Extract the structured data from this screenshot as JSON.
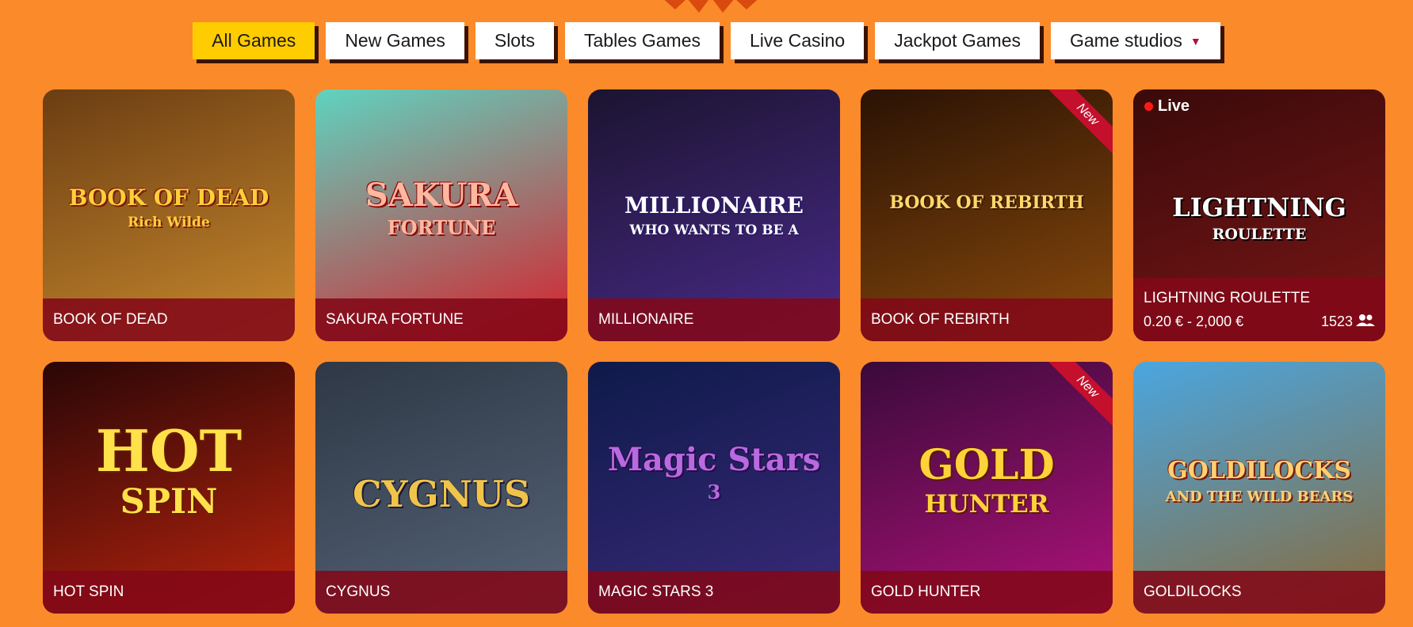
{
  "tabs": [
    {
      "label": "All Games",
      "active": true
    },
    {
      "label": "New Games",
      "active": false
    },
    {
      "label": "Slots",
      "active": false
    },
    {
      "label": "Tables Games",
      "active": false
    },
    {
      "label": "Live Casino",
      "active": false
    },
    {
      "label": "Jackpot Games",
      "active": false
    },
    {
      "label": "Game studios",
      "active": false,
      "dropdown": true
    }
  ],
  "games": [
    {
      "title": "BOOK OF DEAD",
      "logo": "BOOK OF DEAD",
      "sublogo": "Rich Wilde",
      "colors": [
        "#6b3d12",
        "#c98a2e"
      ]
    },
    {
      "title": "SAKURA FORTUNE",
      "logo": "SAKURA",
      "sublogo": "FORTUNE",
      "colors": [
        "#5fd3c0",
        "#d81f2a"
      ]
    },
    {
      "title": "MILLIONAIRE",
      "logo": "MILLIONAIRE",
      "sublogo": "WHO WANTS TO BE A",
      "colors": [
        "#1b1430",
        "#4a2a8a"
      ]
    },
    {
      "title": "BOOK OF REBIRTH",
      "logo": "BOOK OF REBIRTH",
      "sublogo": "",
      "colors": [
        "#2a1204",
        "#8a4a0c"
      ],
      "badge": "New"
    },
    {
      "title": "LIGHTNING ROULETTE",
      "logo": "LIGHTNING",
      "sublogo": "ROULETTE",
      "colors": [
        "#3a0a0a",
        "#7a1616"
      ],
      "live": "Live",
      "limits": "0.20 € - 2,000 €",
      "players": "1523"
    },
    {
      "title": "HOT SPIN",
      "logo": "HOT",
      "sublogo": "SPIN",
      "colors": [
        "#2a0606",
        "#b8240e"
      ]
    },
    {
      "title": "CYGNUS",
      "logo": "CYGNUS",
      "sublogo": "",
      "colors": [
        "#2e3846",
        "#566476"
      ]
    },
    {
      "title": "MAGIC STARS 3",
      "logo": "Magic Stars",
      "sublogo": "3",
      "colors": [
        "#0e1a4a",
        "#3a2a7a"
      ]
    },
    {
      "title": "GOLD HUNTER",
      "logo": "GOLD",
      "sublogo": "HUNTER",
      "colors": [
        "#3a0a3a",
        "#b0127a"
      ],
      "badge": "New"
    },
    {
      "title": "GOLDILOCKS",
      "logo": "GOLDILOCKS",
      "sublogo": "AND THE WILD BEARS",
      "colors": [
        "#4aa6e0",
        "#8a6a3a"
      ]
    }
  ]
}
